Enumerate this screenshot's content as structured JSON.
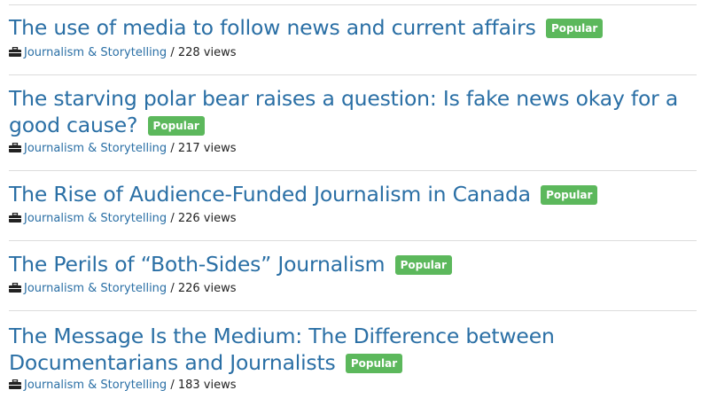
{
  "articles": [
    {
      "title": "The use of media to follow news and current affairs",
      "badge": "Popular",
      "category": "Journalism & Storytelling",
      "views": "228 views"
    },
    {
      "title": "The starving polar bear raises a question: Is fake news okay for a good cause?",
      "badge": "Popular",
      "category": "Journalism & Storytelling",
      "views": "217 views"
    },
    {
      "title": "The Rise of Audience-Funded Journalism in Canada",
      "badge": "Popular",
      "category": "Journalism & Storytelling",
      "views": "226 views"
    },
    {
      "title": "The Perils of “Both-Sides” Journalism",
      "badge": "Popular",
      "category": "Journalism & Storytelling",
      "views": "226 views"
    },
    {
      "title": "The Message Is the Medium: The Difference between Documentarians and Journalists",
      "badge": "Popular",
      "category": "Journalism & Storytelling",
      "views": "183 views"
    }
  ],
  "meta_separator": " / ",
  "icons": {
    "category": "briefcase-icon"
  },
  "colors": {
    "link": "#2a6fa5",
    "badge": "#5cb85c"
  }
}
